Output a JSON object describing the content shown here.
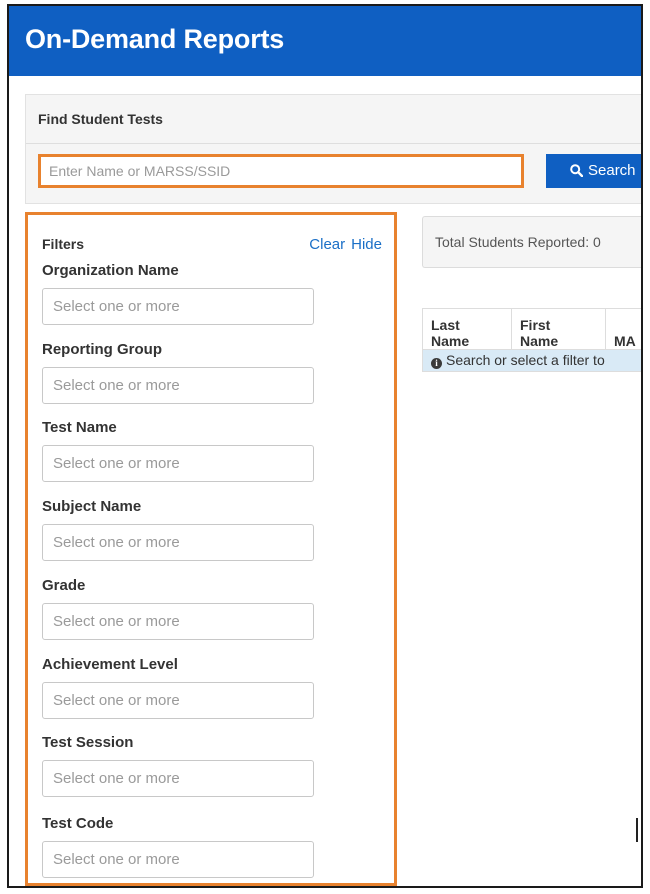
{
  "header": {
    "title": "On-Demand Reports"
  },
  "find": {
    "title": "Find Student Tests",
    "search_placeholder": "Enter Name or MARSS/SSID",
    "search_button": "Search",
    "search_icon": "search-icon"
  },
  "filters": {
    "title": "Filters",
    "clear_label": "Clear",
    "hide_label": "Hide",
    "fields": [
      {
        "label": "Organization Name",
        "placeholder": "Select one or more"
      },
      {
        "label": "Reporting Group",
        "placeholder": "Select one or more"
      },
      {
        "label": "Test Name",
        "placeholder": "Select one or more"
      },
      {
        "label": "Subject Name",
        "placeholder": "Select one or more"
      },
      {
        "label": "Grade",
        "placeholder": "Select one or more"
      },
      {
        "label": "Achievement Level",
        "placeholder": "Select one or more"
      },
      {
        "label": "Test Session",
        "placeholder": "Select one or more"
      },
      {
        "label": "Test Code",
        "placeholder": "Select one or more"
      }
    ]
  },
  "summary": {
    "total_text": "Total Students Reported: 0"
  },
  "results": {
    "columns": [
      {
        "line1": "Last",
        "line2": "Name"
      },
      {
        "line1": "First",
        "line2": "Name"
      },
      {
        "line1": "MA",
        "line2": ""
      }
    ],
    "empty_message": "Search or select a filter to",
    "info_icon": "info-icon"
  },
  "colors": {
    "header_bg": "#0f5fc2",
    "accent_outline": "#e8822e",
    "link": "#1a6fc7",
    "info_row_bg": "#d9eaf6"
  }
}
